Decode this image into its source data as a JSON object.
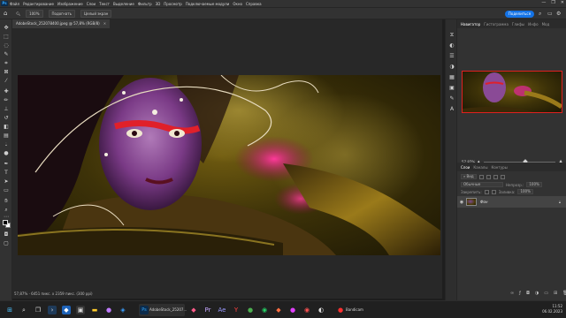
{
  "menu": {
    "app_logo": "Ps",
    "items": [
      "Файл",
      "Редактирование",
      "Изображение",
      "Слои",
      "Текст",
      "Выделение",
      "Фильтр",
      "3D",
      "Просмотр",
      "Подключаемые модули",
      "Окно",
      "Справка"
    ],
    "window_controls": [
      "—",
      "❐",
      "✕"
    ]
  },
  "options": {
    "zoom_value": "100%",
    "fit_button": "Подогнать",
    "fullscreen_button": "Целый экран",
    "share_button": "Поделиться"
  },
  "document": {
    "tab_title": "AdobeStock_252078400.jpeg @ 57,8% (RGB/8)",
    "status": "57,87% · 6451 пикс. x 2359 пикс. (300 ppi)"
  },
  "navigator": {
    "tabs": [
      "Навигатор",
      "Гистограмма",
      "Глифы",
      "Инфо",
      "Мод"
    ],
    "zoom": "57,87%"
  },
  "layers": {
    "tabs": [
      "Слои",
      "Каналы",
      "Контуры"
    ],
    "filter_label": "Вид",
    "blend_mode": "Обычные",
    "opacity_label": "Непрозр.:",
    "opacity": "100%",
    "lock_label": "Закрепить:",
    "fill_label": "Заливка:",
    "fill": "100%",
    "items": [
      {
        "name": "Фон",
        "visible": true
      }
    ]
  },
  "taskbar": {
    "active_app_label": "AdobeStock_25207...",
    "recorder_label": "Bandicam",
    "time": "11:52",
    "date": "06.02.2023"
  },
  "colors": {
    "accent": "#1473e6",
    "panel": "#323232",
    "canvas_bg": "#282828"
  }
}
